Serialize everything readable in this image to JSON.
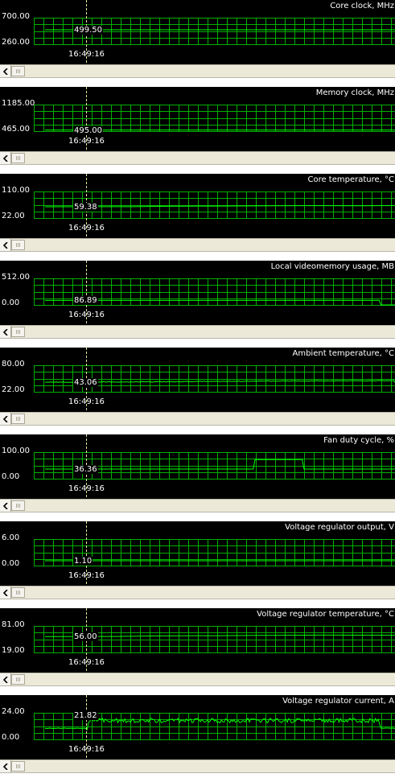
{
  "cursor_time": "16:49:16",
  "panels": [
    {
      "title": "Core clock, MHz",
      "ymax": "700.00",
      "ymin": "260.00",
      "current": "499.50",
      "min": 260,
      "max": 700,
      "trace": [
        [
          0,
          499.5
        ],
        [
          1,
          499.5
        ]
      ]
    },
    {
      "title": "Memory clock, MHz",
      "ymax": "1185.00",
      "ymin": "465.00",
      "current": "495.00",
      "min": 465,
      "max": 1185,
      "trace": [
        [
          0,
          495
        ],
        [
          1,
          495
        ]
      ]
    },
    {
      "title": "Core temperature, °C",
      "ymax": "110.00",
      "ymin": "22.00",
      "current": "59.38",
      "min": 22,
      "max": 110,
      "trace": [
        [
          0,
          59.4
        ],
        [
          0.25,
          59.6
        ],
        [
          0.35,
          61
        ],
        [
          0.5,
          61.8
        ],
        [
          0.65,
          62.5
        ],
        [
          0.8,
          63.1
        ],
        [
          0.9,
          62.6
        ],
        [
          1,
          63.2
        ]
      ]
    },
    {
      "title": "Local videomemory usage, MB",
      "ymax": "512.00",
      "ymin": "0.00",
      "current": "86.89",
      "min": 0,
      "max": 512,
      "trace": [
        [
          0,
          86.89
        ],
        [
          0.955,
          86.89
        ],
        [
          0.96,
          0
        ],
        [
          1,
          0
        ]
      ]
    },
    {
      "title": "Ambient temperature, °C",
      "ymax": "80.00",
      "ymin": "22.00",
      "current": "43.06",
      "min": 22,
      "max": 80,
      "trace": [
        [
          0,
          43.06
        ],
        [
          0.3,
          43.8
        ],
        [
          0.5,
          44.9
        ],
        [
          0.7,
          45.6
        ],
        [
          0.9,
          46.1
        ],
        [
          1,
          46.5
        ]
      ],
      "noisy": true
    },
    {
      "title": "Fan duty cycle, %",
      "ymax": "100.00",
      "ymin": "0.00",
      "current": "36.36",
      "min": 0,
      "max": 100,
      "trace": [
        [
          0,
          36.36
        ],
        [
          0.595,
          36.36
        ],
        [
          0.6,
          72
        ],
        [
          0.735,
          72
        ],
        [
          0.74,
          36.36
        ],
        [
          1,
          36.36
        ]
      ]
    },
    {
      "title": "Voltage regulator output, V",
      "ymax": "6.00",
      "ymin": "0.00",
      "current": "1.10",
      "min": 0,
      "max": 6,
      "trace": [
        [
          0,
          1.1
        ],
        [
          1,
          1.1
        ]
      ]
    },
    {
      "title": "Voltage regulator temperature, °C",
      "ymax": "81.00",
      "ymin": "19.00",
      "current": "56.00",
      "min": 19,
      "max": 81,
      "trace": [
        [
          0,
          56
        ],
        [
          0.2,
          56.4
        ],
        [
          0.3,
          57.5
        ],
        [
          0.5,
          58.3
        ],
        [
          0.6,
          59
        ],
        [
          0.8,
          59.5
        ],
        [
          1,
          59.3
        ]
      ]
    },
    {
      "title": "Voltage regulator current, A",
      "ymax": "24.00",
      "ymin": "0.00",
      "current": "21.82",
      "min": 0,
      "max": 24,
      "trace": [
        [
          0,
          10
        ],
        [
          0.12,
          10
        ],
        [
          0.125,
          17
        ],
        [
          0.955,
          17
        ],
        [
          0.96,
          10
        ],
        [
          1,
          10
        ]
      ],
      "noisy": true
    }
  ],
  "colors": {
    "grid": "#00b000",
    "trace": "#00ff00",
    "cursor": "#e8e8a0",
    "background": "#000000"
  }
}
